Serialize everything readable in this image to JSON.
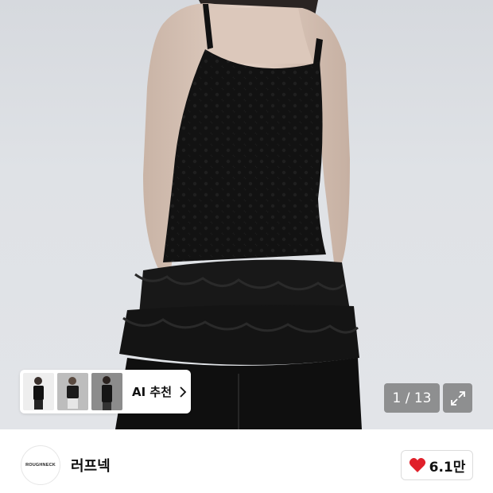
{
  "gallery": {
    "counter": "1 / 13",
    "ai_recommend_label": "AI 추천"
  },
  "brand": {
    "logo_text": "ROUGHNECK",
    "name": "러프넥"
  },
  "like": {
    "count": "6.1만",
    "heart_color": "#e0202a"
  }
}
